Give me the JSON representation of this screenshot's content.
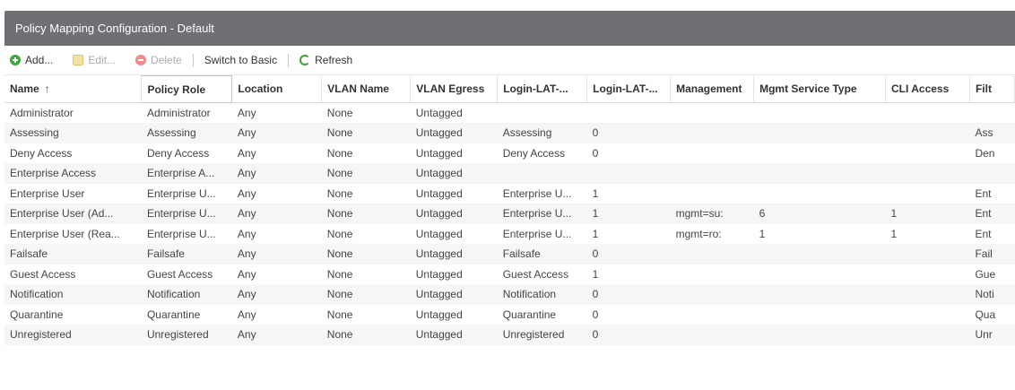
{
  "panel": {
    "title": "Policy Mapping Configuration - Default"
  },
  "toolbar": {
    "add_label": "Add...",
    "edit_label": "Edit...",
    "delete_label": "Delete",
    "switch_label": "Switch to Basic",
    "refresh_label": "Refresh"
  },
  "table": {
    "columns": [
      "Name",
      "Policy Role",
      "Location",
      "VLAN Name",
      "VLAN Egress",
      "Login-LAT-...",
      "Login-LAT-...",
      "Management",
      "Mgmt Service Type",
      "CLI Access",
      "Filt"
    ],
    "sort_indicator": "↑",
    "rows": [
      [
        "Administrator",
        "Administrator",
        "Any",
        "None",
        "Untagged",
        "",
        "",
        "",
        "",
        "",
        ""
      ],
      [
        "Assessing",
        "Assessing",
        "Any",
        "None",
        "Untagged",
        "Assessing",
        "0",
        "",
        "",
        "",
        "Ass"
      ],
      [
        "Deny Access",
        "Deny Access",
        "Any",
        "None",
        "Untagged",
        "Deny Access",
        "0",
        "",
        "",
        "",
        "Den"
      ],
      [
        "Enterprise Access",
        "Enterprise A...",
        "Any",
        "None",
        "Untagged",
        "",
        "",
        "",
        "",
        "",
        ""
      ],
      [
        "Enterprise User",
        "Enterprise U...",
        "Any",
        "None",
        "Untagged",
        "Enterprise U...",
        "1",
        "",
        "",
        "",
        "Ent"
      ],
      [
        "Enterprise User (Ad...",
        "Enterprise U...",
        "Any",
        "None",
        "Untagged",
        "Enterprise U...",
        "1",
        "mgmt=su:",
        "6",
        "1",
        "Ent"
      ],
      [
        "Enterprise User (Rea...",
        "Enterprise U...",
        "Any",
        "None",
        "Untagged",
        "Enterprise U...",
        "1",
        "mgmt=ro:",
        "1",
        "1",
        "Ent"
      ],
      [
        "Failsafe",
        "Failsafe",
        "Any",
        "None",
        "Untagged",
        "Failsafe",
        "0",
        "",
        "",
        "",
        "Fail"
      ],
      [
        "Guest Access",
        "Guest Access",
        "Any",
        "None",
        "Untagged",
        "Guest Access",
        "1",
        "",
        "",
        "",
        "Gue"
      ],
      [
        "Notification",
        "Notification",
        "Any",
        "None",
        "Untagged",
        "Notification",
        "0",
        "",
        "",
        "",
        "Noti"
      ],
      [
        "Quarantine",
        "Quarantine",
        "Any",
        "None",
        "Untagged",
        "Quarantine",
        "0",
        "",
        "",
        "",
        "Qua"
      ],
      [
        "Unregistered",
        "Unregistered",
        "Any",
        "None",
        "Untagged",
        "Unregistered",
        "0",
        "",
        "",
        "",
        "Unr"
      ]
    ]
  }
}
